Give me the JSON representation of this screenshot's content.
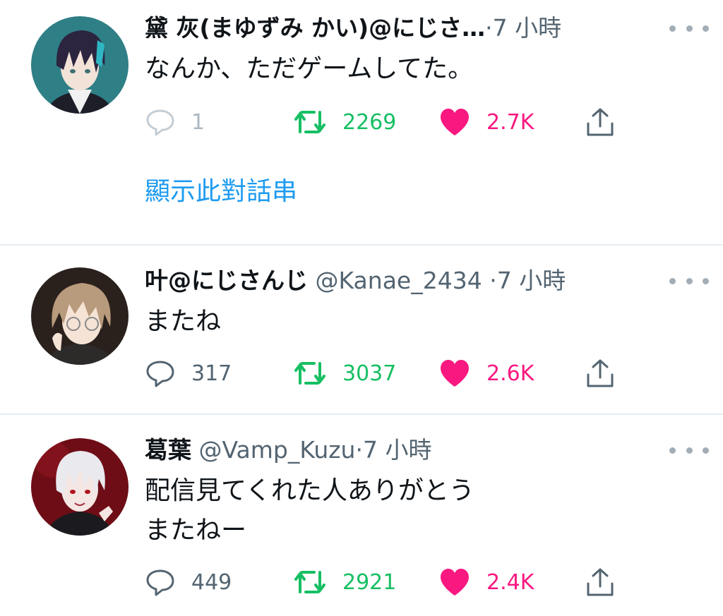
{
  "tweets": [
    {
      "name": "黛 灰(まゆずみ かい)@にじさ…",
      "handle": "",
      "dot": "·",
      "time": "7 小時",
      "text": "なんか、ただゲームしてた。",
      "replies": "1",
      "retweets": "2269",
      "likes": "2.7K",
      "show_thread": "顯示此對話串",
      "avatar": {
        "bg": "#2f7f86",
        "hair": "#2b2540",
        "accent": "#2fb6c4",
        "skin": "#f3e2d8"
      }
    },
    {
      "name": "叶@にじさんじ",
      "handle": "@Kanae_2434",
      "dot": "·",
      "time": "7 小時",
      "text": "またね",
      "replies": "317",
      "retweets": "3037",
      "likes": "2.6K",
      "avatar": {
        "bg": "#2a211d",
        "hair": "#b89a7c",
        "accent": "#d6c0a4",
        "skin": "#f5e3d6"
      }
    },
    {
      "name": "葛葉",
      "handle": "@Vamp_Kuzu",
      "dot": "·",
      "time": "7 小時",
      "text_lines": [
        "配信見てくれた人ありがとう",
        "またねー"
      ],
      "replies": "449",
      "retweets": "2921",
      "likes": "2.4K",
      "avatar": {
        "bg": "#6e0d16",
        "hair": "#e9e9ee",
        "accent": "#b3121f",
        "skin": "#f4e6e2"
      }
    }
  ],
  "icons": {
    "reply": "speech-bubble-icon",
    "retweet": "retweet-arrows-icon",
    "like": "heart-icon",
    "share": "share-upload-icon",
    "more": "ellipsis-icon"
  },
  "colors": {
    "retweet_green": "#17bf63",
    "like_pink": "#f91880",
    "link_blue": "#1d9bf0",
    "secondary_gray": "#536471",
    "divider": "#e6ecf0"
  }
}
